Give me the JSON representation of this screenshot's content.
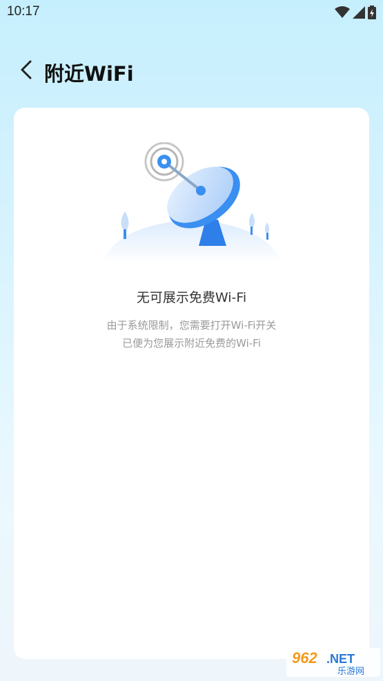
{
  "status_bar": {
    "time": "10:17",
    "icons": [
      "wifi-icon",
      "signal-icon",
      "battery-icon"
    ]
  },
  "header": {
    "back_icon": "chevron-left-icon",
    "title": "附近WiFi"
  },
  "empty_state": {
    "illustration": "satellite-dish-illustration",
    "title": "无可展示免费Wi-Fi",
    "description_line1": "由于系统限制，您需要打开Wi-Fi开关",
    "description_line2": "已便为您展示附近免费的Wi-Fi"
  },
  "watermark": {
    "brand": "962.NET",
    "sub": "乐游网"
  },
  "colors": {
    "accent_blue": "#3a8ff0",
    "bg_top": "#c6effd",
    "text_dark": "#333333",
    "text_muted": "#9a9a9a"
  }
}
